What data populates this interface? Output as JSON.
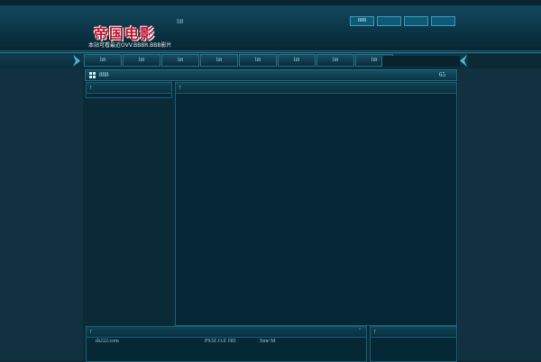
{
  "header": {
    "logo_title": "帝国电影",
    "logo_sub": "本站可看最近OVV.BBBR.BBB影片",
    "center_text": "li8",
    "buttons": [
      "888",
      "",
      "",
      ""
    ]
  },
  "nav": {
    "tabs": [
      "li8",
      "li8",
      "li8",
      "li8",
      "li8",
      "li8",
      "li8",
      "li8"
    ]
  },
  "subheader": {
    "title": "888",
    "count": "65"
  },
  "panels": {
    "pin": "↑",
    "bottom_mark": "▫"
  },
  "footer": {
    "site": "tlt222.com",
    "quality": "PS3Z.O.E HD",
    "name": "Sme M"
  },
  "colors": {
    "background": "#0e2a36",
    "header_gradient_top": "#12495c",
    "accent_border": "#2b7f98",
    "logo_red": "#c0102a",
    "pin_green": "#9fe3a8"
  }
}
